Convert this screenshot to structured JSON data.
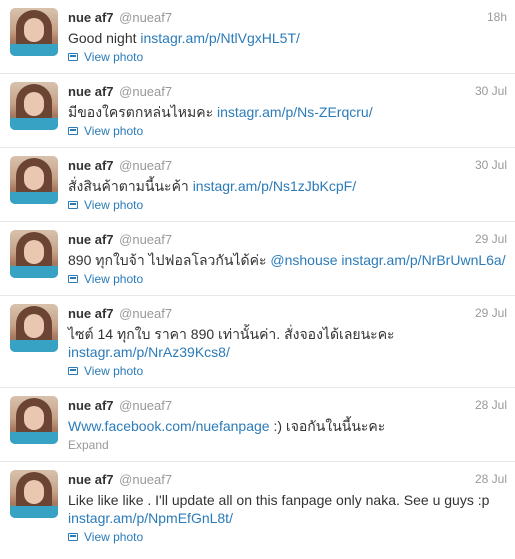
{
  "timeline": {
    "tweets": [
      {
        "fullname": "nue af7",
        "username": "@nueaf7",
        "time": "18h",
        "text": "Good night ",
        "link1": "instagr.am/p/NtlVgxHL5T/",
        "action": "View photo"
      },
      {
        "fullname": "nue af7",
        "username": "@nueaf7",
        "time": "30 Jul",
        "text": "มีของใครตกหล่นไหมคะ ",
        "link1": "instagr.am/p/Ns-ZErqcru/",
        "action": "View photo"
      },
      {
        "fullname": "nue af7",
        "username": "@nueaf7",
        "time": "30 Jul",
        "text": "สั่งสินค้าตามนี้นะค้า ",
        "link1": "instagr.am/p/Ns1zJbKcpF/",
        "action": "View photo"
      },
      {
        "fullname": "nue af7",
        "username": "@nueaf7",
        "time": "29 Jul",
        "text": "890 ทุกใบจ้า ไปฟอลโลวกันได้ค่ะ ",
        "link1": "@nshouse",
        "link2": "instagr.am/p/NrBrUwnL6a/",
        "action": "View photo"
      },
      {
        "fullname": "nue af7",
        "username": "@nueaf7",
        "time": "29 Jul",
        "text": "ไซต์ 14 ทุกใบ ราคา 890 เท่านั้นค่า. สั่งจองได้เลยนะคะ",
        "link1": "instagr.am/p/NrAz39Kcs8/",
        "action": "View photo"
      },
      {
        "fullname": "nue af7",
        "username": "@nueaf7",
        "time": "28 Jul",
        "link1": "Www.facebook.com/nuefanpage",
        "text": " :) เจอกันในนี้นะคะ",
        "action": "Expand"
      },
      {
        "fullname": "nue af7",
        "username": "@nueaf7",
        "time": "28 Jul",
        "text": "Like like like . I'll update all on this fanpage only naka. See u guys :p",
        "link1": "instagr.am/p/NpmEfGnL8t/",
        "action": "View photo"
      }
    ]
  }
}
